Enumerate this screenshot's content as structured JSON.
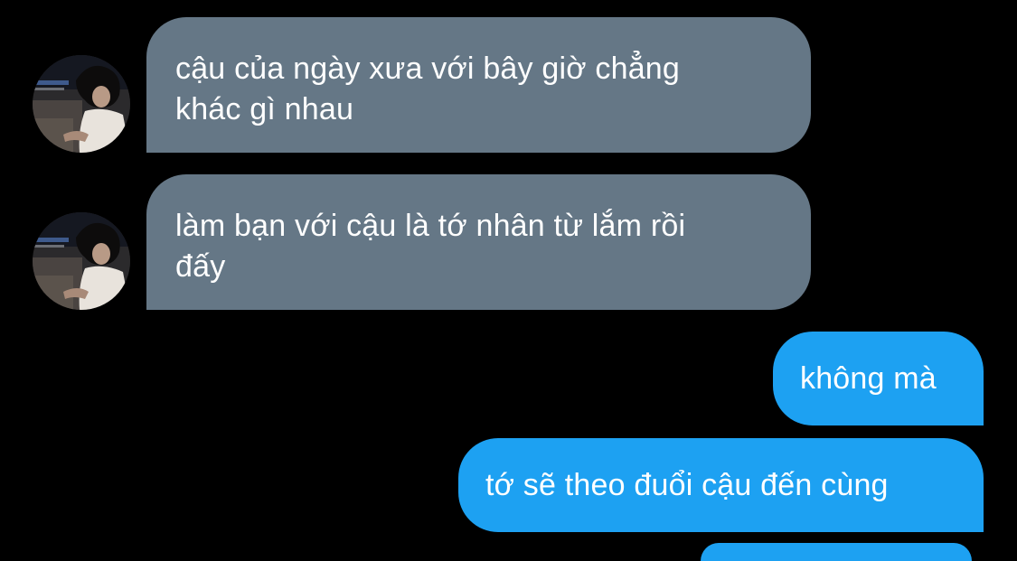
{
  "conversation": {
    "incoming": [
      {
        "lines": [
          "cậu của ngày xưa với bây giờ chẳng",
          "khác gì nhau"
        ]
      },
      {
        "lines": [
          "làm bạn với cậu là tớ nhân từ lắm rồi",
          "đấy"
        ]
      }
    ],
    "outgoing": [
      {
        "text": "không mà"
      },
      {
        "text": "tớ sẽ theo đuổi cậu đến cùng"
      }
    ]
  },
  "colors": {
    "background": "#000000",
    "incoming_bubble": "#657786",
    "outgoing_bubble": "#1DA1F2",
    "text": "#FFFFFF"
  },
  "icons": {
    "avatar": "avatar-photo-icon"
  }
}
